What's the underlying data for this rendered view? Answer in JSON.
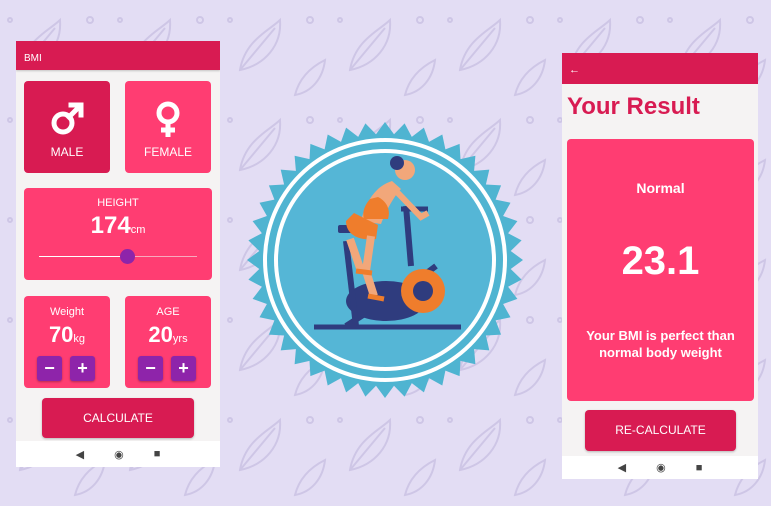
{
  "colors": {
    "background": "#e3ddf4",
    "primary": "#d81b52",
    "card": "#ff3d72",
    "accent": "#8e24aa"
  },
  "calculator": {
    "appbar_title": "BMI",
    "gender": {
      "male_label": "MALE",
      "male_icon": "male-symbol-icon",
      "female_label": "FEMALE",
      "female_icon": "female-symbol-icon",
      "selected": "male"
    },
    "height": {
      "label": "HEIGHT",
      "value": "174",
      "unit": "cm",
      "slider_fraction": 0.56
    },
    "weight": {
      "label": "Weight",
      "value": "70",
      "unit": "kg"
    },
    "age": {
      "label": "AGE",
      "value": "20",
      "unit": "yrs"
    },
    "stepper": {
      "minus": "−",
      "plus": "+"
    },
    "calculate_label": "CALCULATE",
    "nav": {
      "back": "◀",
      "home": "◉",
      "recents": "■"
    }
  },
  "illustration": {
    "icon": "stationary-bike-badge-icon"
  },
  "result": {
    "back_icon": "back-arrow-icon",
    "back_glyph": "←",
    "title": "Your Result",
    "status": "Normal",
    "bmi_value": "23.1",
    "message": "Your BMI is perfect than normal body weight",
    "recalculate_label": "RE-CALCULATE",
    "nav": {
      "back": "◀",
      "home": "◉",
      "recents": "■"
    }
  }
}
